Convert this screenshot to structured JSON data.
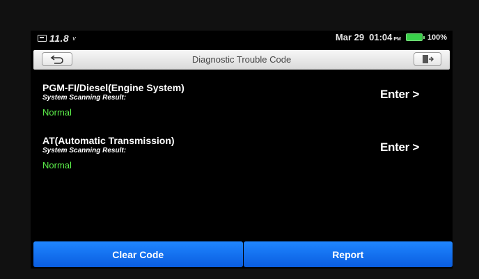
{
  "status": {
    "voltage": "11.8",
    "voltage_unit": "v",
    "date": "Mar 29",
    "time": "01:04",
    "ampm": "PM",
    "battery_percent": "100%"
  },
  "header": {
    "title": "Diagnostic Trouble Code"
  },
  "systems": [
    {
      "name": "PGM-FI/Diesel(Engine System)",
      "scan_label": "System Scanning Result:",
      "result": "Normal",
      "action": "Enter >"
    },
    {
      "name": "AT(Automatic Transmission)",
      "scan_label": "System Scanning Result:",
      "result": "Normal",
      "action": "Enter >"
    }
  ],
  "footer": {
    "clear_label": "Clear Code",
    "report_label": "Report"
  },
  "colors": {
    "result_normal": "#5cf04a",
    "button_blue": "#1473f0",
    "battery_green": "#39d04a"
  }
}
